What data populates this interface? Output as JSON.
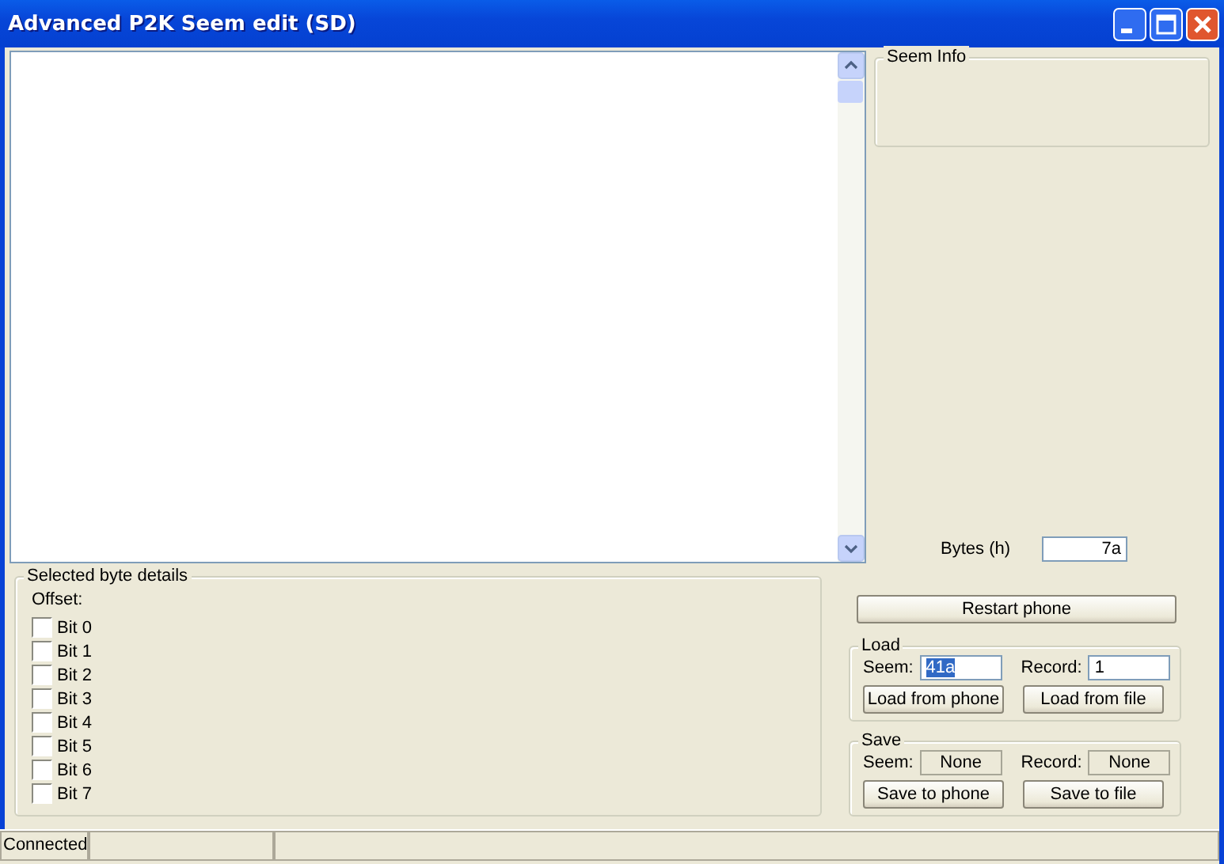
{
  "window": {
    "title": "Advanced P2K Seem edit (SD)"
  },
  "seem_info": {
    "title": "Seem Info"
  },
  "bytes": {
    "label": "Bytes (h)",
    "value": "7a"
  },
  "byte_details": {
    "title": "Selected byte details",
    "offset_label": "Offset:",
    "bits": [
      {
        "label": "Bit 0",
        "checked": false
      },
      {
        "label": "Bit 1",
        "checked": false
      },
      {
        "label": "Bit 2",
        "checked": false
      },
      {
        "label": "Bit 3",
        "checked": false
      },
      {
        "label": "Bit 4",
        "checked": false
      },
      {
        "label": "Bit 5",
        "checked": false
      },
      {
        "label": "Bit 6",
        "checked": false
      },
      {
        "label": "Bit 7",
        "checked": false
      }
    ]
  },
  "restart_button": "Restart phone",
  "load": {
    "title": "Load",
    "seem_label": "Seem:",
    "seem_value": "41a",
    "seem_value_selected": true,
    "record_label": "Record:",
    "record_value": "1",
    "buttons": [
      "Load from phone",
      "Load from file"
    ]
  },
  "save": {
    "title": "Save",
    "seem_label": "Seem:",
    "seem_value": "None",
    "record_label": "Record:",
    "record_value": "None",
    "buttons": [
      "Save to phone",
      "Save to file"
    ]
  },
  "status_bar": {
    "panels": [
      "Connected"
    ]
  }
}
